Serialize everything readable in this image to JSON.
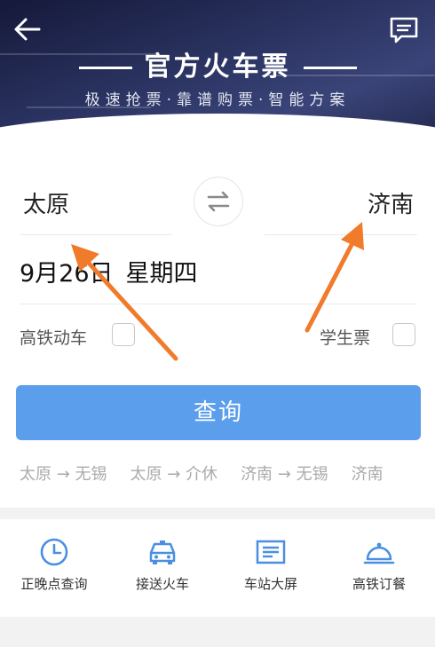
{
  "header": {
    "title": "官方火车票",
    "subtitle": "极速抢票·靠谱购票·智能方案",
    "back_icon": "back-arrow-icon",
    "message_icon": "message-icon"
  },
  "search": {
    "from_station": "太原",
    "to_station": "济南",
    "swap_icon": "swap-arrows-icon",
    "date": "9月26日",
    "weekday": "星期四",
    "options": {
      "high_speed_label": "高铁动车",
      "student_label": "学生票"
    },
    "query_button": "查询"
  },
  "history": [
    {
      "text": "太原 → 无锡"
    },
    {
      "text": "太原 → 介休"
    },
    {
      "text": "济南 → 无锡"
    },
    {
      "text": "济南"
    }
  ],
  "services": [
    {
      "label": "正晚点查询",
      "icon": "clock-icon"
    },
    {
      "label": "接送火车",
      "icon": "car-icon"
    },
    {
      "label": "车站大屏",
      "icon": "station-screen-icon"
    },
    {
      "label": "高铁订餐",
      "icon": "meal-cloche-icon"
    }
  ],
  "colors": {
    "accent_blue": "#5b9eeb",
    "banner_dark": "#1e2449",
    "annotation_orange": "#f07b2a"
  }
}
